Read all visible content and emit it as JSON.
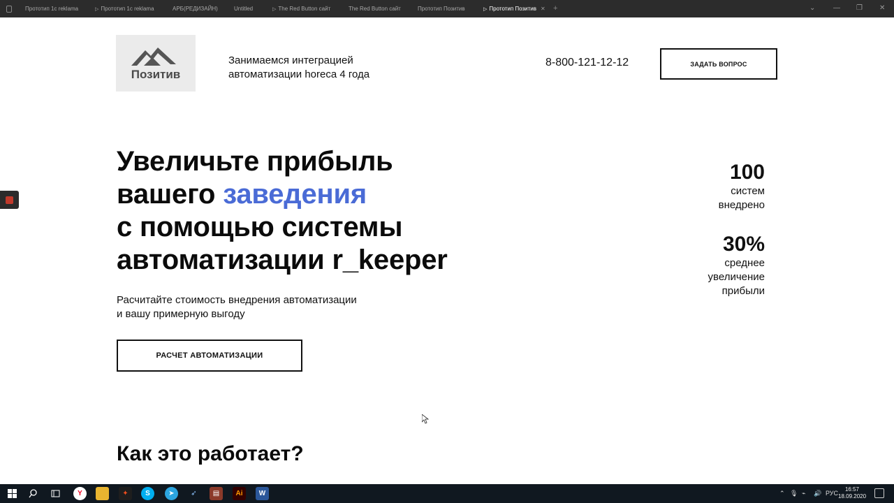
{
  "tabs": [
    {
      "label": "Прототип 1c reklama",
      "play": false
    },
    {
      "label": "Прототип 1c reklama",
      "play": true
    },
    {
      "label": "АРБ(РЕДИЗАЙН)",
      "play": false
    },
    {
      "label": "Untitled",
      "play": false
    },
    {
      "label": "The Red Button сайт",
      "play": true
    },
    {
      "label": "The Red Button сайт",
      "play": false
    },
    {
      "label": "Прототип Позитив",
      "play": false
    },
    {
      "label": "Прототип Позитив",
      "play": true,
      "active": true
    }
  ],
  "header": {
    "logo_text": "Позитив",
    "tagline": "Занимаемся интеграцией автоматизации horeca 4 года",
    "phone": "8-800-121-12-12",
    "ask_button": "ЗАДАТЬ ВОПРОС"
  },
  "hero": {
    "line1": "Увеличьте прибыль",
    "line2_pre": "вашего ",
    "line2_accent": "заведения",
    "line3": "с помощью системы",
    "line4": "автоматизации r_keeper",
    "subtitle_line1": "Расчитайте стоимость внедрения автоматизации",
    "subtitle_line2": "и вашу примерную выгоду",
    "calc_button": "РАСЧЕТ АВТОМАТИЗАЦИИ"
  },
  "stats": [
    {
      "number": "100",
      "lines": [
        "систем",
        "внедрено"
      ]
    },
    {
      "number": "30%",
      "lines": [
        "среднее",
        "увеличение",
        "прибыли"
      ]
    }
  ],
  "section_title": "Как это работает?",
  "taskbar": {
    "lang": "РУС",
    "time": "16:57",
    "date": "18.09.2020"
  },
  "colors": {
    "accent": "#4a6bd6",
    "tabbar": "#2c2c2c",
    "taskbar": "#101820"
  }
}
